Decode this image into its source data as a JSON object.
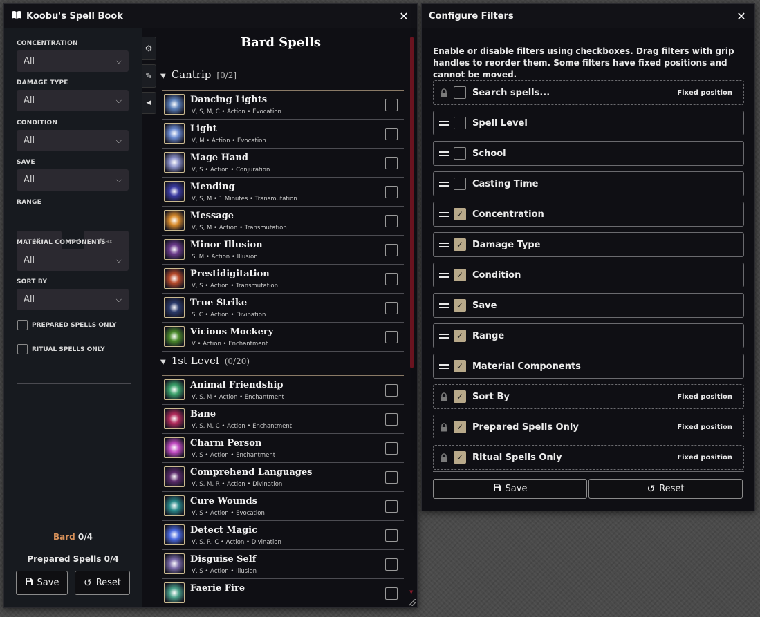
{
  "spellbook": {
    "title": "Koobu's Spell Book",
    "filters": [
      {
        "label": "CONCENTRATION",
        "value": "All"
      },
      {
        "label": "DAMAGE TYPE",
        "value": "All"
      },
      {
        "label": "CONDITION",
        "value": "All"
      },
      {
        "label": "SAVE",
        "value": "All"
      },
      {
        "label": "RANGE",
        "min_placeholder": "Min",
        "max_placeholder": "Max"
      },
      {
        "label": "MATERIAL COMPONENTS",
        "value": "All"
      },
      {
        "label": "SORT BY",
        "value": "All"
      }
    ],
    "checks": [
      "PREPARED SPELLS ONLY",
      "RITUAL SPELLS ONLY"
    ],
    "tally": {
      "class_name": "Bard",
      "class_count": "0/4",
      "prepared_label": "Prepared Spells",
      "prepared_count": "0/4"
    },
    "save_label": "Save",
    "reset_label": "Reset",
    "heading": "Bard Spells",
    "sections": [
      {
        "name": "Cantrip",
        "count": "[0/2]",
        "spells": [
          {
            "name": "Dancing Lights",
            "meta": "V, S, M, C • Action • Evocation",
            "icon_color": "#5a7fb8"
          },
          {
            "name": "Light",
            "meta": "V, M • Action • Evocation",
            "icon_color": "#6a8ad0"
          },
          {
            "name": "Mage Hand",
            "meta": "V, S • Action • Conjuration",
            "icon_color": "#8a90c8"
          },
          {
            "name": "Mending",
            "meta": "V, S, M • 1 Minutes • Transmutation",
            "icon_color": "#3a3aa0"
          },
          {
            "name": "Message",
            "meta": "V, S, M • Action • Transmutation",
            "icon_color": "#d88a2a"
          },
          {
            "name": "Minor Illusion",
            "meta": "S, M • Action • Illusion",
            "icon_color": "#6a3a8a"
          },
          {
            "name": "Prestidigitation",
            "meta": "V, S • Action • Transmutation",
            "icon_color": "#b84a2a"
          },
          {
            "name": "True Strike",
            "meta": "S, C • Action • Divination",
            "icon_color": "#2a3a6a"
          },
          {
            "name": "Vicious Mockery",
            "meta": "V • Action • Enchantment",
            "icon_color": "#4a8a2a"
          }
        ]
      },
      {
        "name": "1st Level",
        "count": "(0/20)",
        "spells": [
          {
            "name": "Animal Friendship",
            "meta": "V, S, M • Action • Enchantment",
            "icon_color": "#3aa06a"
          },
          {
            "name": "Bane",
            "meta": "V, S, M, C • Action • Enchantment",
            "icon_color": "#b02a5a"
          },
          {
            "name": "Charm Person",
            "meta": "V, S • Action • Enchantment",
            "icon_color": "#c04ac0"
          },
          {
            "name": "Comprehend Languages",
            "meta": "V, S, M, R • Action • Divination",
            "icon_color": "#5a2a6a"
          },
          {
            "name": "Cure Wounds",
            "meta": "V, S • Action • Evocation",
            "icon_color": "#2a8a8a"
          },
          {
            "name": "Detect Magic",
            "meta": "V, S, R, C • Action • Divination",
            "icon_color": "#4a6ae0"
          },
          {
            "name": "Disguise Self",
            "meta": "V, S • Action • Illusion",
            "icon_color": "#7a6aa8"
          },
          {
            "name": "Faerie Fire",
            "meta": "",
            "icon_color": "#4aa08a"
          }
        ]
      }
    ]
  },
  "config": {
    "title": "Configure Filters",
    "description": "Enable or disable filters using checkboxes. Drag filters with grip handles to reorder them. Some filters have fixed positions and cannot be moved.",
    "fixed_label": "Fixed position",
    "rows": [
      {
        "label": "Search spells...",
        "checked": false,
        "fixed": true
      },
      {
        "label": "Spell Level",
        "checked": false,
        "fixed": false
      },
      {
        "label": "School",
        "checked": false,
        "fixed": false
      },
      {
        "label": "Casting Time",
        "checked": false,
        "fixed": false
      },
      {
        "label": "Concentration",
        "checked": true,
        "fixed": false
      },
      {
        "label": "Damage Type",
        "checked": true,
        "fixed": false
      },
      {
        "label": "Condition",
        "checked": true,
        "fixed": false
      },
      {
        "label": "Save",
        "checked": true,
        "fixed": false
      },
      {
        "label": "Range",
        "checked": true,
        "fixed": false
      },
      {
        "label": "Material Components",
        "checked": true,
        "fixed": false
      },
      {
        "label": "Sort By",
        "checked": true,
        "fixed": true
      },
      {
        "label": "Prepared Spells Only",
        "checked": true,
        "fixed": true
      },
      {
        "label": "Ritual Spells Only",
        "checked": true,
        "fixed": true
      }
    ],
    "save_label": "Save",
    "reset_label": "Reset"
  },
  "colors": {
    "accent": "#b8a98a",
    "class_name": "#d9925a",
    "scrollbar": "#6a1420"
  }
}
